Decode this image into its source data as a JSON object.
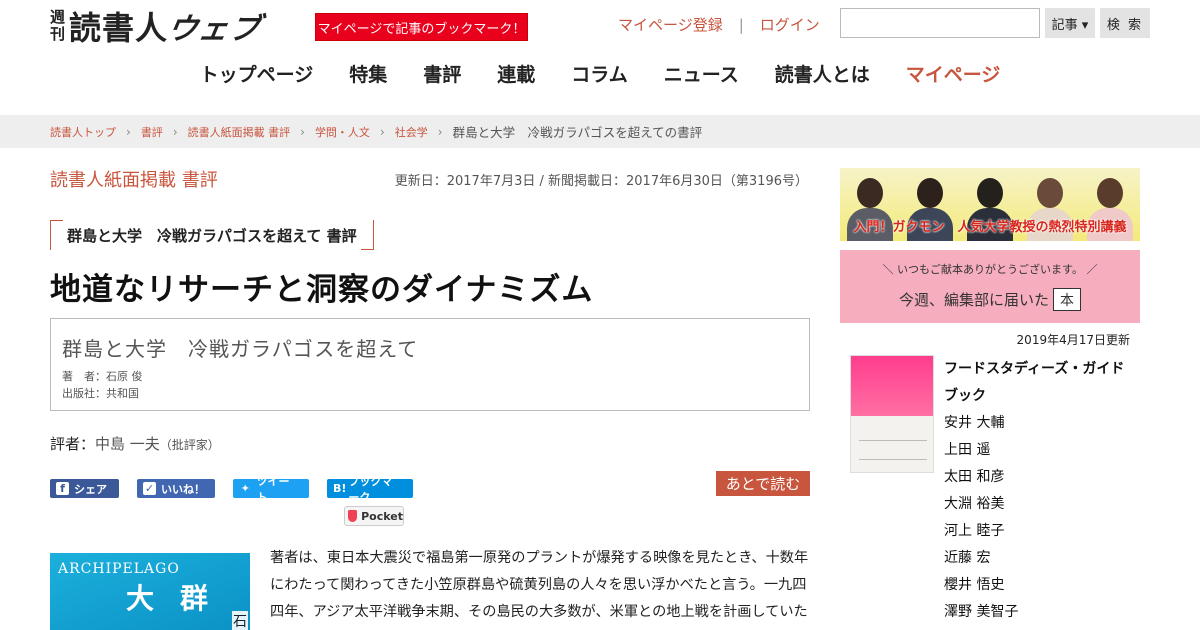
{
  "header": {
    "logo_small_1": "週",
    "logo_small_2": "刊",
    "logo_main": "読書人",
    "logo_web": "ウェブ",
    "promo_badge": "マイページで記事のブックマーク！",
    "register_link": "マイページ登録",
    "separator": "|",
    "login_link": "ログイン",
    "search_placeholder": "",
    "search_select_value": "記事 ▾",
    "search_button": "検 索"
  },
  "nav": {
    "items": [
      "トップページ",
      "特集",
      "書評",
      "連載",
      "コラム",
      "ニュース",
      "読書人とは",
      "マイページ"
    ]
  },
  "breadcrumb": {
    "items": [
      "読書人トップ",
      "書評",
      "読書人紙面掲載 書評",
      "学問・人文",
      "社会学"
    ],
    "current": "群島と大学　冷戦ガラパゴスを超えての書評"
  },
  "article": {
    "section_title": "読書人紙面掲載 書評",
    "dates": "更新日：2017年7月3日 / 新聞掲載日：2017年6月30日（第3196号）",
    "book_tag": "群島と大学　冷戦ガラパゴスを超えて 書評",
    "headline": "地道なリサーチと洞察のダイナミズム",
    "book_title": "群島と大学　冷戦ガラパゴスを超えて",
    "book_author": "著　者：石原 俊",
    "book_publisher": "出版社：共和国",
    "reviewer_label": "評者：",
    "reviewer_name": "中島 一夫",
    "reviewer_role": "（批評家）",
    "body": "著者は、東日本大震災で福島第一原発のプラントが爆発する映像を見たとき、十数年にわたって関わってきた小笠原群島や硫黄列島の人々を思い浮かべたと言う。一九四四年、アジア太平洋戦争末期、その島民の大多数が、米軍との地上戦を計画していた"
  },
  "share": {
    "facebook": "シェア",
    "like": "いいね！",
    "tweet": "ツイート",
    "hatena": "ブックマーク",
    "hatena_icon": "B!",
    "pocket": "Pocket",
    "read_later": "あとで読む"
  },
  "book_cover": {
    "en": "ARCHIPELAGO",
    "jp1": "大",
    "jp2": "群",
    "side": "石"
  },
  "sidebar": {
    "banner1_text": "入門！ガクモン　人気大学教授の熱烈特別講義",
    "banner2_top": "＼ いつもご献本ありがとうございます。 ／",
    "banner2_main": "今週、編集部に届いた",
    "banner2_box": "本",
    "updated": "2019年4月17日更新",
    "book_title": "フードスタディーズ・ガイドブック",
    "authors": [
      "安井 大輔",
      "上田 遥",
      "太田 和彦",
      "大淵 裕美",
      "河上 睦子",
      "近藤 宏",
      "櫻井 悟史",
      "澤野 美智子"
    ]
  },
  "colors": {
    "accent": "#c8553d",
    "promo_red": "#e8001c",
    "breadcrumb_bg": "#eeeeee"
  }
}
